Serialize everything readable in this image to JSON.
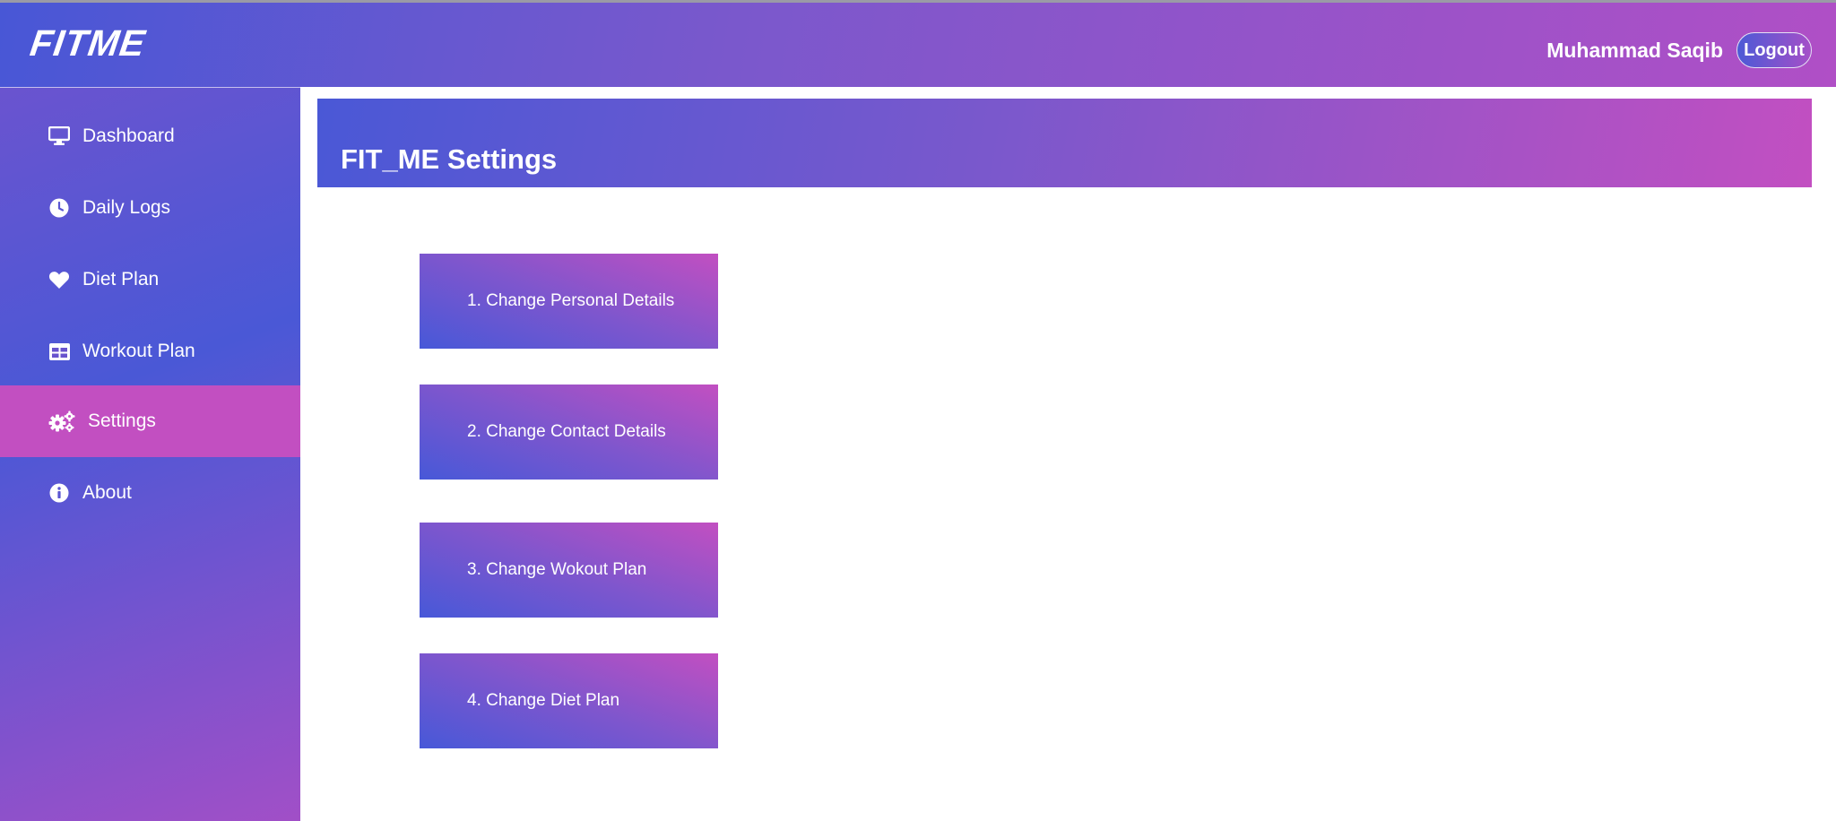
{
  "header": {
    "logo": "FITME",
    "username": "Muhammad Saqib",
    "logout_label": "Logout"
  },
  "sidebar": {
    "items": [
      {
        "label": "Dashboard",
        "icon": "monitor-icon"
      },
      {
        "label": "Daily Logs",
        "icon": "clock-icon"
      },
      {
        "label": "Diet Plan",
        "icon": "heart-icon"
      },
      {
        "label": "Workout Plan",
        "icon": "table-icon"
      },
      {
        "label": "Settings",
        "icon": "gears-icon",
        "active": true
      },
      {
        "label": "About",
        "icon": "info-icon"
      }
    ]
  },
  "main": {
    "title": "FIT_ME Settings",
    "options": [
      "1. Change Personal Details",
      "2. Change Contact Details",
      "3. Change Wokout Plan",
      "4. Change Diet Plan"
    ]
  },
  "colors": {
    "accent_blue": "#4a58d6",
    "accent_magenta": "#c24fc1",
    "text": "#ffffff"
  }
}
